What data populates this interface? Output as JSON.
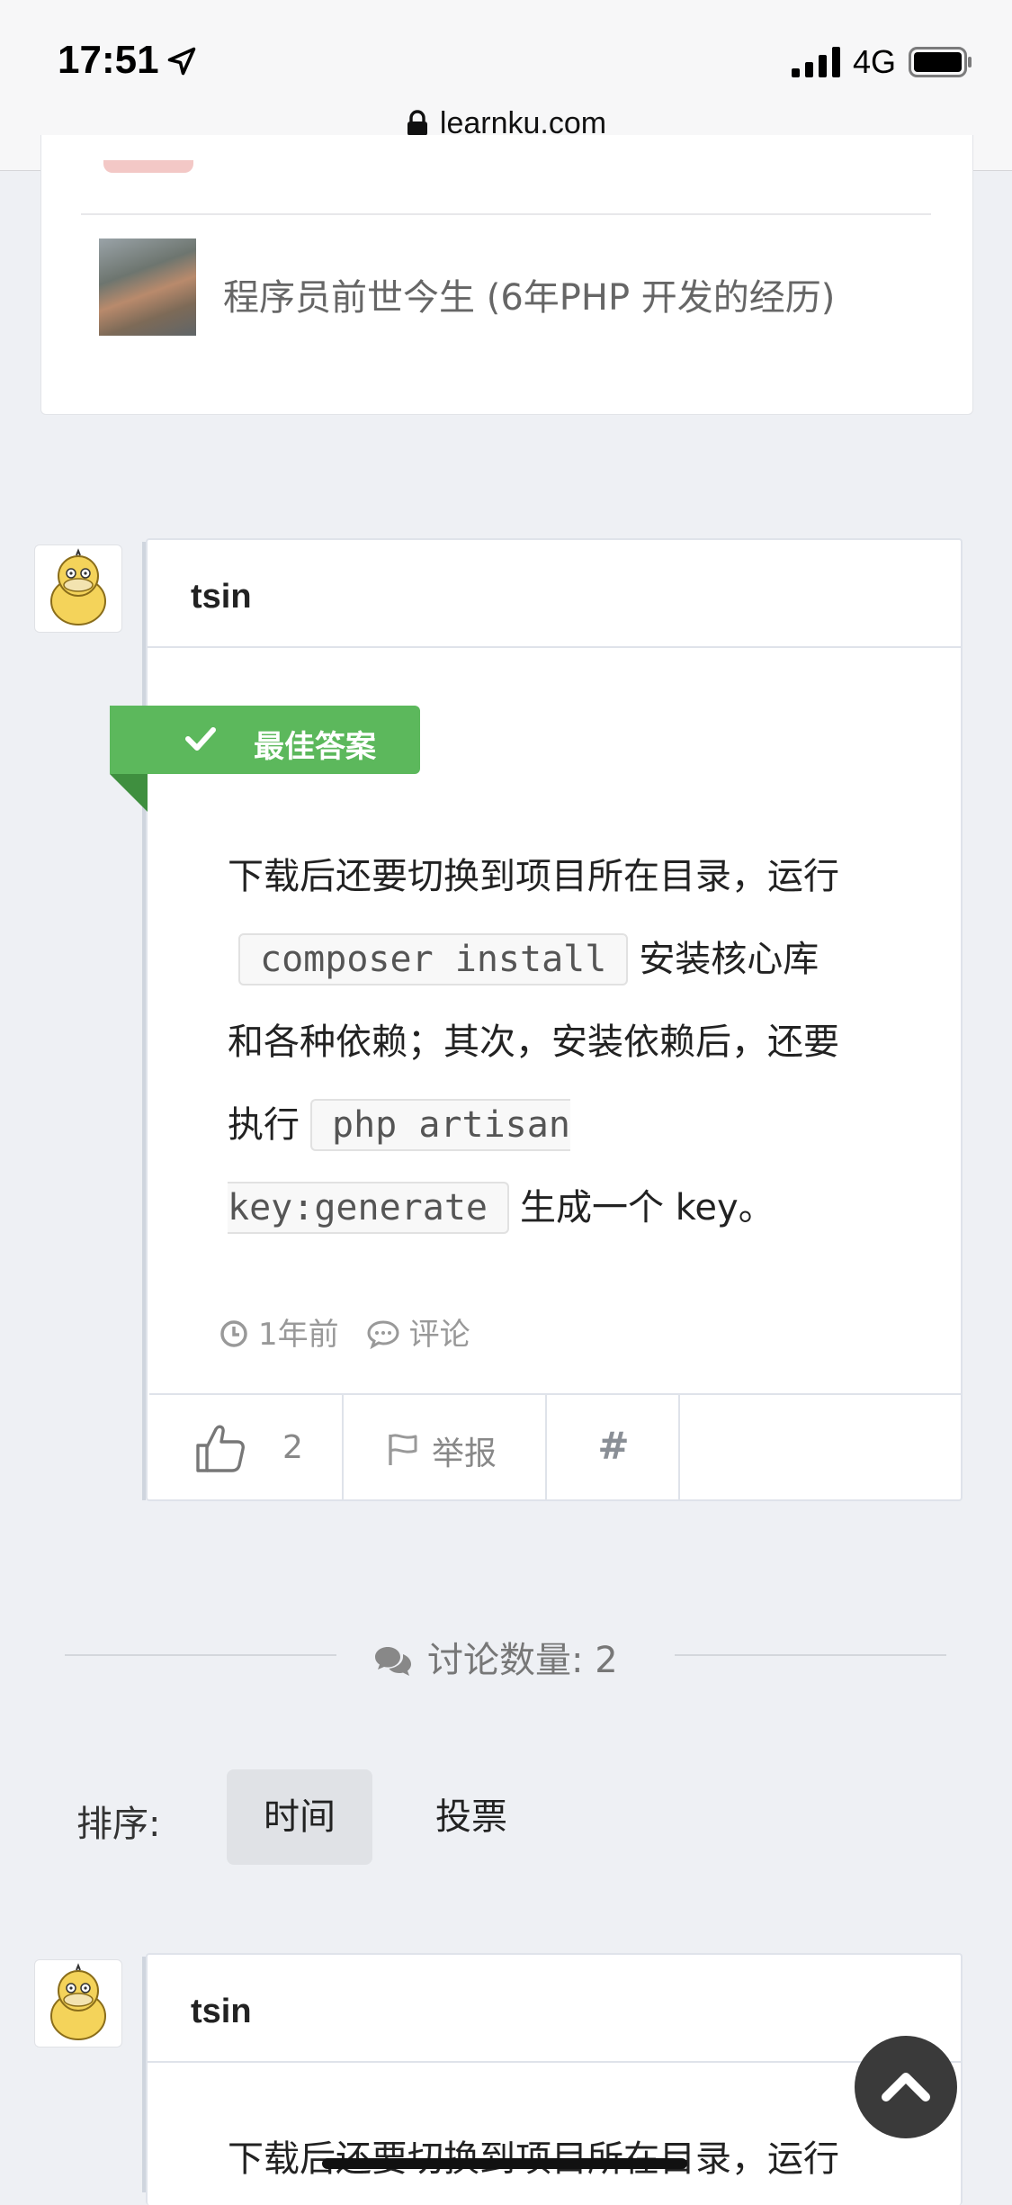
{
  "status_bar": {
    "time": "17:51",
    "network": "4G"
  },
  "browser": {
    "url": "learnku.com"
  },
  "related": {
    "title": "程序员前世今生 (6年PHP 开发的经历)"
  },
  "answer": {
    "author": "tsin",
    "badge": "最佳答案",
    "lines": {
      "l1": "下载后还要切换到项目所在目录，运行",
      "code1": "composer install",
      "l2_after": "安装核心库",
      "l3": "和各种依赖；其次，安装依赖后，还要",
      "l4_before": "执行",
      "code2a": "php artisan",
      "code2b": "key:generate",
      "l5_after": "生成一个 key。"
    },
    "time_ago": "1年前",
    "comment_label": "评论",
    "likes": "2",
    "report_label": "举报",
    "permalink_label": "#"
  },
  "discussion": {
    "label": "讨论数量: 2"
  },
  "sort": {
    "label": "排序:",
    "options": [
      "时间",
      "投票"
    ],
    "selected": "时间"
  },
  "second_reply": {
    "author": "tsin",
    "preview": "下载后还要切换到项目所在目录，运行"
  },
  "colors": {
    "badge_green": "#5cb85c",
    "page_bg": "#eef0f4"
  }
}
